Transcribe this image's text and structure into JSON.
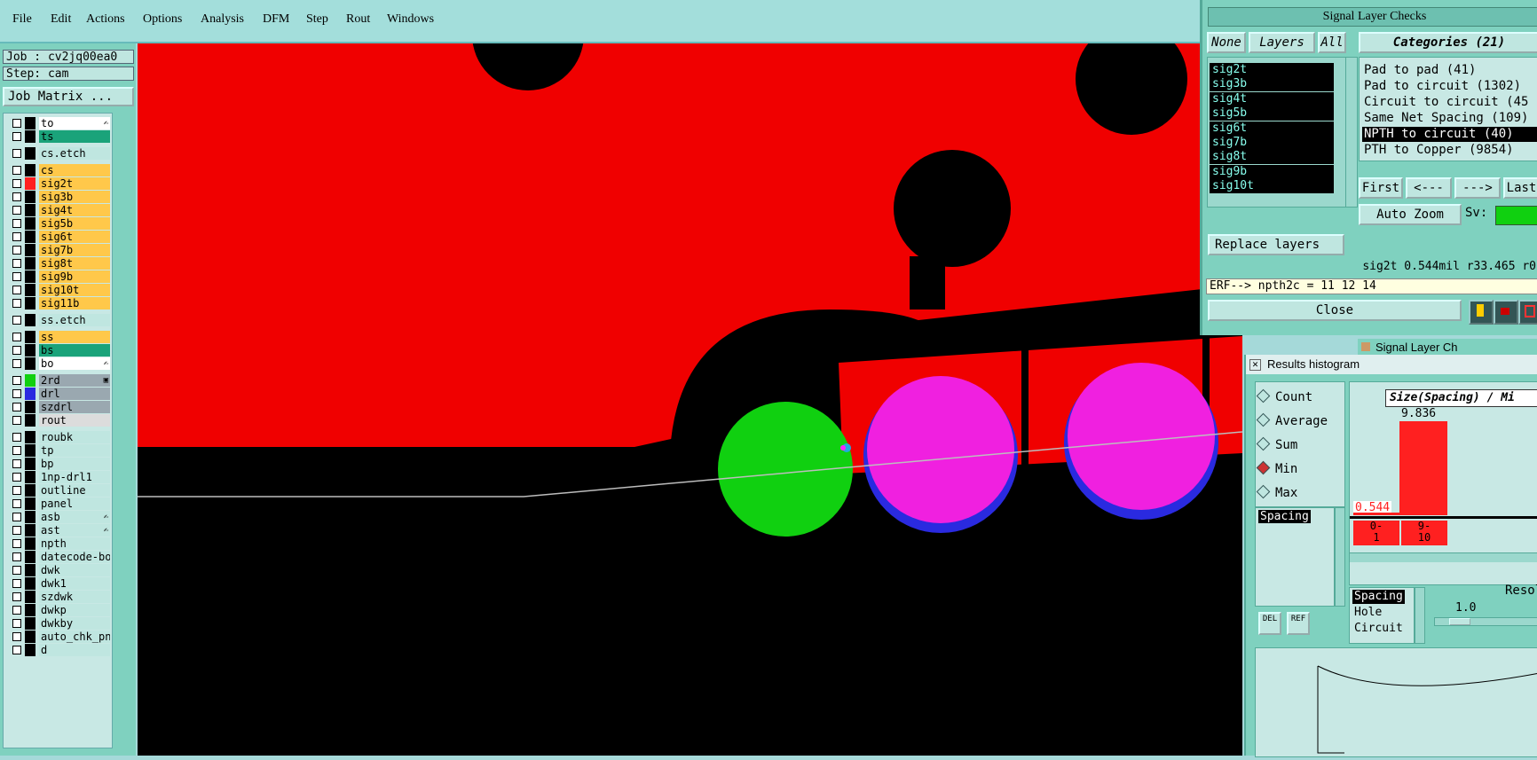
{
  "menu": [
    "File",
    "Edit",
    "Actions",
    "Options",
    "Analysis",
    "DFM",
    "Step",
    "Rout",
    "Windows"
  ],
  "job": {
    "job_label": "Job : cv2jq00ea0",
    "step_label": "Step: cam",
    "matrix_button": "Job Matrix ..."
  },
  "layers": [
    {
      "name": "to",
      "color": "#ffffff",
      "sw": "#000000",
      "icon": "✍"
    },
    {
      "name": "ts",
      "color": "#1aa37a",
      "sw": "#000000",
      "icon": ""
    },
    {
      "name": "cs.etch",
      "color": "#bfe6e0",
      "sw": "#000000",
      "icon": ""
    },
    {
      "name": "cs",
      "color": "#ffc84a",
      "sw": "#000000",
      "icon": ""
    },
    {
      "name": "sig2t",
      "color": "#ffc84a",
      "sw": "#ff2020",
      "icon": ""
    },
    {
      "name": "sig3b",
      "color": "#ffc84a",
      "sw": "#000000",
      "icon": ""
    },
    {
      "name": "sig4t",
      "color": "#ffc84a",
      "sw": "#000000",
      "icon": ""
    },
    {
      "name": "sig5b",
      "color": "#ffc84a",
      "sw": "#000000",
      "icon": ""
    },
    {
      "name": "sig6t",
      "color": "#ffc84a",
      "sw": "#000000",
      "icon": ""
    },
    {
      "name": "sig7b",
      "color": "#ffc84a",
      "sw": "#000000",
      "icon": ""
    },
    {
      "name": "sig8t",
      "color": "#ffc84a",
      "sw": "#000000",
      "icon": ""
    },
    {
      "name": "sig9b",
      "color": "#ffc84a",
      "sw": "#000000",
      "icon": ""
    },
    {
      "name": "sig10t",
      "color": "#ffc84a",
      "sw": "#000000",
      "icon": ""
    },
    {
      "name": "sig11b",
      "color": "#ffc84a",
      "sw": "#000000",
      "icon": ""
    },
    {
      "name": "ss.etch",
      "color": "#bfe6e0",
      "sw": "#000000",
      "icon": ""
    },
    {
      "name": "ss",
      "color": "#ffc84a",
      "sw": "#000000",
      "icon": ""
    },
    {
      "name": "bs",
      "color": "#1aa37a",
      "sw": "#000000",
      "icon": ""
    },
    {
      "name": "bo",
      "color": "#ffffff",
      "sw": "#000000",
      "icon": "✍"
    },
    {
      "name": "2rd",
      "color": "#9aa8b0",
      "sw": "#10d010",
      "icon": "▣"
    },
    {
      "name": "drl",
      "color": "#9aa8b0",
      "sw": "#2a2ae0",
      "icon": ""
    },
    {
      "name": "szdrl",
      "color": "#9aa8b0",
      "sw": "#000000",
      "icon": ""
    },
    {
      "name": "rout",
      "color": "#dcdcdc",
      "sw": "#000000",
      "icon": ""
    },
    {
      "name": "roubk",
      "color": "#bfe6e0",
      "sw": "#000000",
      "icon": ""
    },
    {
      "name": "tp",
      "color": "#bfe6e0",
      "sw": "#000000",
      "icon": ""
    },
    {
      "name": "bp",
      "color": "#bfe6e0",
      "sw": "#000000",
      "icon": ""
    },
    {
      "name": "1np-drl1",
      "color": "#bfe6e0",
      "sw": "#000000",
      "icon": ""
    },
    {
      "name": "outline",
      "color": "#bfe6e0",
      "sw": "#000000",
      "icon": ""
    },
    {
      "name": "panel",
      "color": "#bfe6e0",
      "sw": "#000000",
      "icon": ""
    },
    {
      "name": "asb",
      "color": "#bfe6e0",
      "sw": "#000000",
      "icon": "✍"
    },
    {
      "name": "ast",
      "color": "#bfe6e0",
      "sw": "#000000",
      "icon": "✍"
    },
    {
      "name": "npth",
      "color": "#bfe6e0",
      "sw": "#000000",
      "icon": ""
    },
    {
      "name": "datecode-bo",
      "color": "#bfe6e0",
      "sw": "#000000",
      "icon": ""
    },
    {
      "name": "dwk",
      "color": "#bfe6e0",
      "sw": "#000000",
      "icon": ""
    },
    {
      "name": "dwk1",
      "color": "#bfe6e0",
      "sw": "#000000",
      "icon": ""
    },
    {
      "name": "szdwk",
      "color": "#bfe6e0",
      "sw": "#000000",
      "icon": ""
    },
    {
      "name": "dwkp",
      "color": "#bfe6e0",
      "sw": "#000000",
      "icon": ""
    },
    {
      "name": "dwkby",
      "color": "#bfe6e0",
      "sw": "#000000",
      "icon": ""
    },
    {
      "name": "auto_chk_pn",
      "color": "#bfe6e0",
      "sw": "#000000",
      "icon": ""
    },
    {
      "name": "d",
      "color": "#bfe6e0",
      "sw": "#000000",
      "icon": ""
    }
  ],
  "signal": {
    "title": "Signal Layer Checks",
    "none": "None",
    "layers": "Layers",
    "all": "All",
    "categories_title": "Categories (21)",
    "sig_layers": [
      "sig2t",
      "sig3b",
      "sig4t",
      "sig5b",
      "sig6t",
      "sig7b",
      "sig8t",
      "sig9b",
      "sig10t"
    ],
    "categories": [
      "Pad to pad (41)",
      "Pad to circuit (1302)",
      "Circuit to circuit (45",
      "Same Net Spacing (109)",
      "NPTH to circuit (40)",
      "PTH to Copper (9854)"
    ],
    "selected_category": "NPTH to circuit (40)",
    "nav": {
      "first": "First",
      "prev": "<---",
      "next": "--->",
      "last": "Last"
    },
    "auto_zoom": "Auto Zoom",
    "sv": "Sv:",
    "replace_layers": "Replace layers",
    "status": "sig2t 0.544mil  r33.465  r0",
    "erf": "ERF--> npth2c = 11 12 14",
    "close": "Close"
  },
  "histogram": {
    "title": "Results histogram",
    "options": [
      "Count",
      "Average",
      "Sum",
      "Min",
      "Max"
    ],
    "selected": "Min",
    "list_item": "Spacing",
    "chart_title": "Size(Spacing) / Mi",
    "bar_top_value": "9.836",
    "bar_low_value": "0.544",
    "bins": [
      {
        "range": "0-",
        "sub": "1"
      },
      {
        "range": "9-",
        "sub": "10"
      }
    ],
    "bottom_list": [
      "Spacing",
      "Hole",
      "Circuit"
    ],
    "resol_label": "Resol",
    "resol_value": "1.0",
    "del_label": "DEL",
    "ref_label": "REF",
    "behind_window_title": "Signal Layer Ch"
  }
}
